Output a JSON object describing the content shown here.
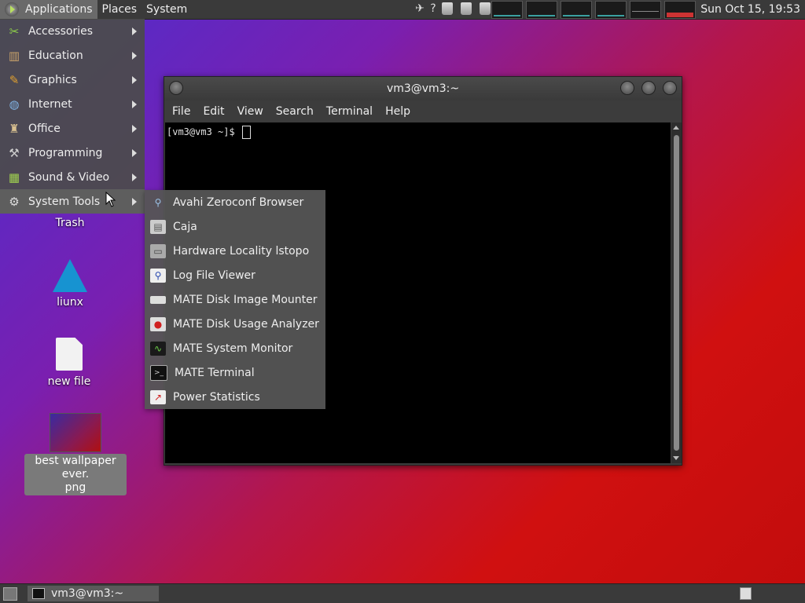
{
  "top_panel": {
    "menus": [
      "Applications",
      "Places",
      "System"
    ],
    "tray_help": "?",
    "clock": "Sun Oct 15, 19:53"
  },
  "apps_menu": {
    "items": [
      {
        "label": "Accessories",
        "icon": "accessories-icon"
      },
      {
        "label": "Education",
        "icon": "education-icon"
      },
      {
        "label": "Graphics",
        "icon": "graphics-icon"
      },
      {
        "label": "Internet",
        "icon": "internet-icon"
      },
      {
        "label": "Office",
        "icon": "office-icon"
      },
      {
        "label": "Programming",
        "icon": "programming-icon"
      },
      {
        "label": "Sound & Video",
        "icon": "sound-video-icon"
      },
      {
        "label": "System Tools",
        "icon": "system-tools-icon"
      }
    ]
  },
  "system_tools_menu": {
    "items": [
      {
        "label": "Avahi Zeroconf Browser",
        "icon": "avahi-icon"
      },
      {
        "label": "Caja",
        "icon": "caja-icon"
      },
      {
        "label": "Hardware Locality lstopo",
        "icon": "lstopo-icon"
      },
      {
        "label": "Log File Viewer",
        "icon": "log-viewer-icon"
      },
      {
        "label": "MATE Disk Image Mounter",
        "icon": "disk-mounter-icon"
      },
      {
        "label": "MATE Disk Usage Analyzer",
        "icon": "disk-usage-icon"
      },
      {
        "label": "MATE System Monitor",
        "icon": "system-monitor-icon"
      },
      {
        "label": "MATE Terminal",
        "icon": "terminal-icon"
      },
      {
        "label": "Power Statistics",
        "icon": "power-stats-icon"
      }
    ]
  },
  "desktop": {
    "icons": [
      {
        "label": "Trash"
      },
      {
        "label": "liunx"
      },
      {
        "label": "new file"
      },
      {
        "label": "best wallpaper ever.\npng"
      }
    ]
  },
  "terminal": {
    "title": "vm3@vm3:~",
    "menus": [
      "File",
      "Edit",
      "View",
      "Search",
      "Terminal",
      "Help"
    ],
    "prompt": "[vm3@vm3 ~]$ "
  },
  "bottom_panel": {
    "task_label": "vm3@vm3:~"
  },
  "colors": {
    "panel": "#3a3a3a",
    "menu_bg": "#4b4b4b",
    "arch_blue": "#1793d1"
  }
}
